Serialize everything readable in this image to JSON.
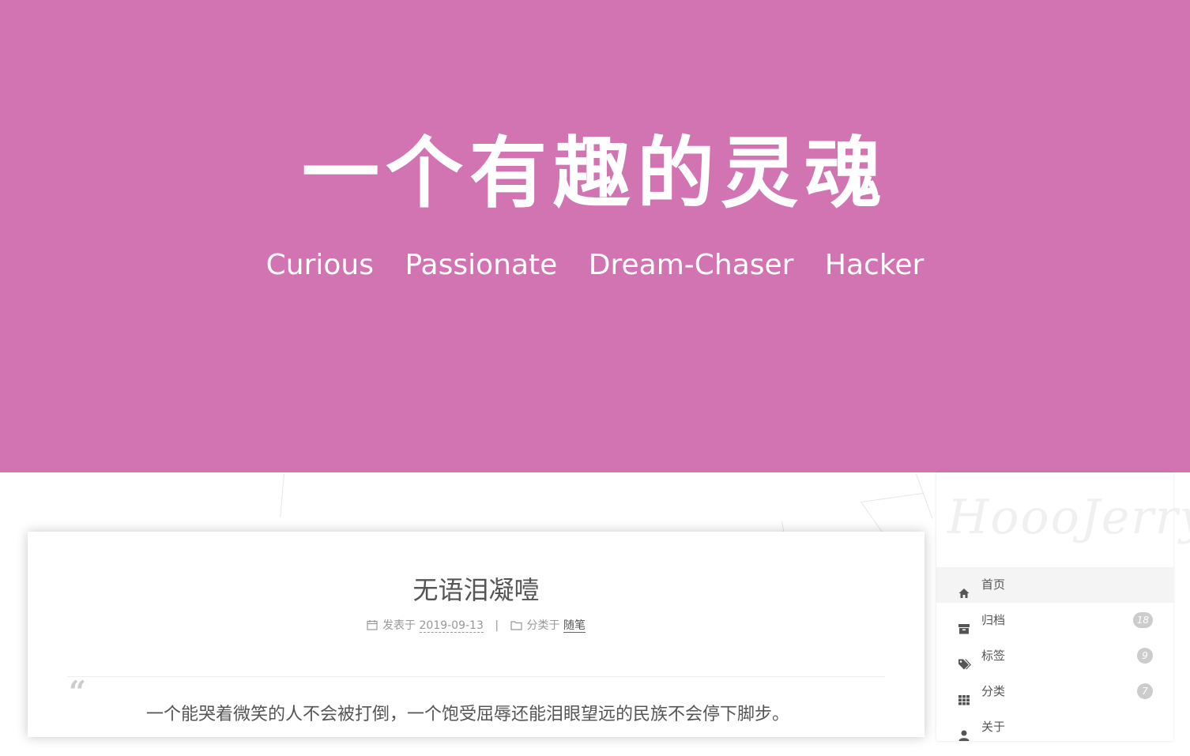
{
  "hero": {
    "title": "一个有趣的灵魂",
    "subtitle_words": [
      "Curious",
      "Passionate",
      "Dream-Chaser",
      "Hacker"
    ],
    "background_color": "#d274b2"
  },
  "post": {
    "title": "无语泪凝噎",
    "posted_label": "发表于",
    "date": "2019-09-13",
    "separator": "|",
    "category_label": "分类于",
    "category": "随笔",
    "quote_mark": "“",
    "quote": "一个能哭着微笑的人不会被打倒，一个饱受屈辱还能泪眼望远的民族不会停下脚步。",
    "icons": {
      "date": "calendar-icon",
      "category": "folder-icon"
    }
  },
  "sidebar": {
    "brand": "HoooJerry",
    "menu": [
      {
        "label": "首页",
        "icon": "home-icon",
        "badge": null,
        "active": true
      },
      {
        "label": "归档",
        "icon": "archive-icon",
        "badge": "18",
        "active": false
      },
      {
        "label": "标签",
        "icon": "tags-icon",
        "badge": "9",
        "active": false
      },
      {
        "label": "分类",
        "icon": "grid-icon",
        "badge": "7",
        "active": false
      },
      {
        "label": "关于",
        "icon": "user-icon",
        "badge": null,
        "active": false
      }
    ]
  }
}
